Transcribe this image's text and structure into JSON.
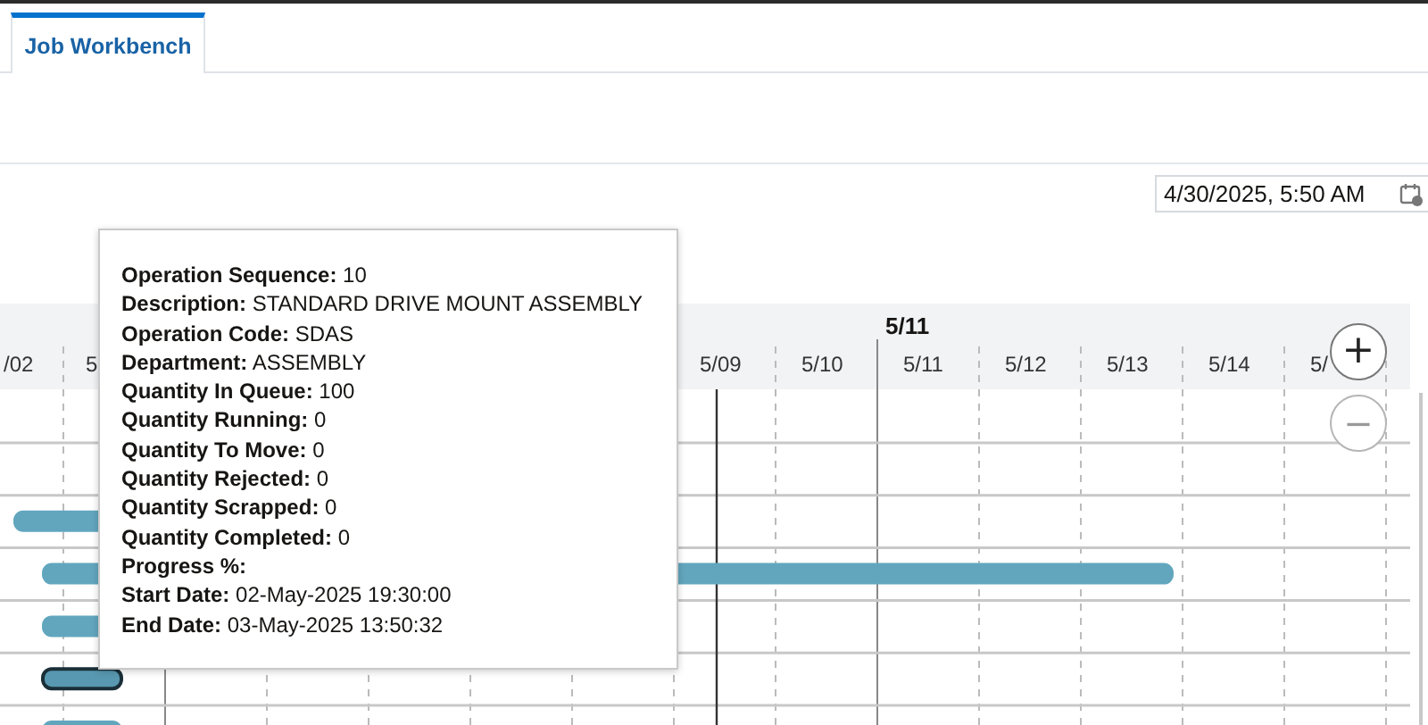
{
  "tabs": [
    {
      "label": "Job Workbench",
      "selected": true
    }
  ],
  "date_field": {
    "value": "4/30/2025, 5:50 AM"
  },
  "gantt": {
    "weeks": [
      "5/11"
    ],
    "days_left": [
      "/02",
      "5"
    ],
    "days_right": [
      "5/09",
      "5/10",
      "5/11",
      "5/12",
      "5/13",
      "5/14",
      "5/"
    ],
    "bars": [
      {
        "selected": false
      },
      {
        "selected": false
      },
      {
        "selected": false
      },
      {
        "selected": true
      },
      {
        "selected": false
      }
    ],
    "zoom_buttons": [
      {
        "label": "+"
      },
      {
        "label": "−"
      }
    ]
  },
  "tooltip": {
    "lines": [
      {
        "label": "Operation Sequence:",
        "value": "10"
      },
      {
        "label": "Description:",
        "value": "STANDARD DRIVE MOUNT ASSEMBLY"
      },
      {
        "label": "Operation Code:",
        "value": "SDAS"
      },
      {
        "label": "Department:",
        "value": "ASSEMBLY"
      },
      {
        "label": "Quantity In Queue:",
        "value": "100"
      },
      {
        "label": "Quantity Running:",
        "value": "0"
      },
      {
        "label": "Quantity To Move:",
        "value": "0"
      },
      {
        "label": "Quantity Rejected:",
        "value": "0"
      },
      {
        "label": "Quantity Scrapped:",
        "value": "0"
      },
      {
        "label": "Quantity Completed:",
        "value": "0"
      },
      {
        "label": "Progress %:"
      },
      {
        "label": "Start Date:",
        "value": "02-May-2025 19:30:00"
      },
      {
        "label": "End Date:",
        "value": "03-May-2025 13:50:32"
      }
    ]
  }
}
